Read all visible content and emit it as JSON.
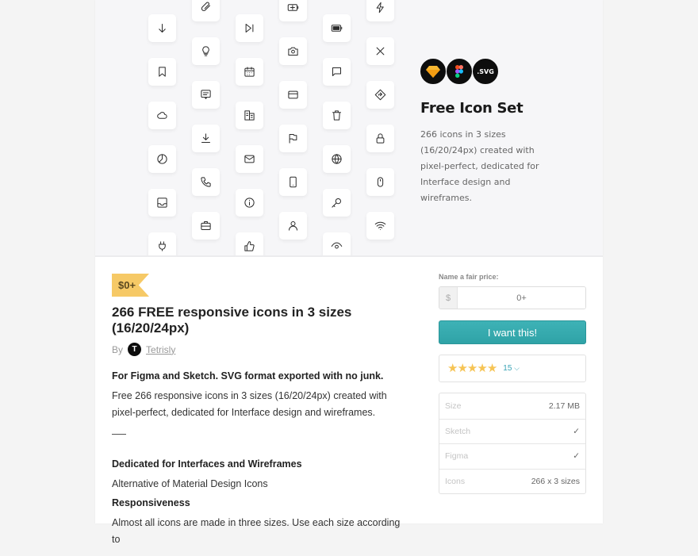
{
  "cover": {
    "badges": [
      {
        "name": "sketch",
        "label": ""
      },
      {
        "name": "figma",
        "label": ""
      },
      {
        "name": "svg",
        "label": ".SVG"
      }
    ],
    "title": "Free Icon Set",
    "description": "266 icons in 3 sizes (16/20/24px) created with pixel-perfect, dedicated for Interface design and wireframes.",
    "icons": [
      [
        "arrow-down-icon",
        "bookmark-icon",
        "cloud-icon",
        "pie-chart-icon",
        "inbox-icon",
        "plug-icon"
      ],
      [
        "paperclip-icon",
        "lightbulb-icon",
        "message-icon",
        "download-icon",
        "phone-icon",
        "briefcase-icon"
      ],
      [
        "skip-forward-icon",
        "calendar-icon",
        "building-icon",
        "mail-icon",
        "info-icon",
        "thumbs-up-icon"
      ],
      [
        "battery-charging-icon",
        "camera-icon",
        "credit-card-icon",
        "flag-icon",
        "smartphone-icon",
        "user-icon"
      ],
      [
        "battery-icon",
        "chat-icon",
        "trash-icon",
        "globe-icon",
        "key-icon",
        "eye-icon"
      ],
      [
        "flash-icon",
        "close-icon",
        "direction-icon",
        "lock-icon",
        "mouse-icon",
        "wifi-icon"
      ]
    ]
  },
  "product": {
    "price_tag": "$0+",
    "title": "266 FREE responsive icons in 3 sizes (16/20/24px)",
    "by_label": "By",
    "author_initial": "T",
    "author": "Tetrisly",
    "description": {
      "heading1": "For Figma and Sketch. SVG format exported with no junk.",
      "para1": "Free 266 responsive icons in 3 sizes (16/20/24px) created with pixel-perfect, dedicated for Interface design and wireframes.",
      "heading2": "Dedicated for Interfaces and Wireframes",
      "para2": "Alternative of Material Design Icons",
      "heading3": "Responsiveness",
      "para3": "Almost all icons are made in three sizes. Use each size according to"
    }
  },
  "sidebar": {
    "price_label": "Name a fair price:",
    "currency": "$",
    "price_placeholder": "0+",
    "buy_button": "I want this!",
    "rating": {
      "stars": 5,
      "max": 5,
      "count": "15",
      "chevron": "⌄"
    },
    "specs": [
      {
        "key": "Size",
        "value": "2.17 MB"
      },
      {
        "key": "Sketch",
        "value": "✓"
      },
      {
        "key": "Figma",
        "value": "✓"
      },
      {
        "key": "Icons",
        "value": "266 x 3 sizes"
      }
    ]
  },
  "colors": {
    "accent": "#34a9ad",
    "price_tag": "#f6c966",
    "star": "#f6c455"
  }
}
